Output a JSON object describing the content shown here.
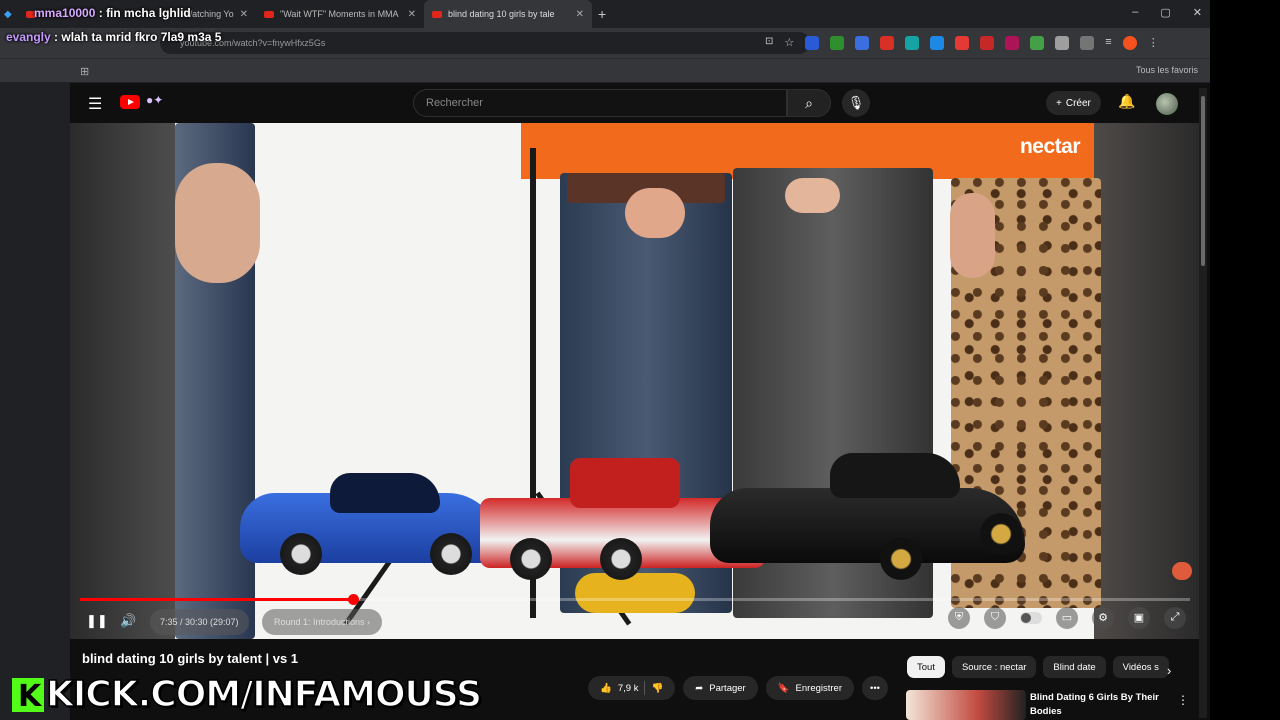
{
  "browser": {
    "tabs": [
      {
        "label": "Watching Yo",
        "active": false
      },
      {
        "label": "\"Wait WTF\" Moments in MMA",
        "active": false
      },
      {
        "label": "blind dating 10 girls by tale",
        "active": true
      }
    ],
    "new_tab": "+",
    "url": "youtube.com/watch?v=fnywHfxz5Gs",
    "bookmarks_folder": "Tous les favoris",
    "window_controls": [
      "–",
      "▢",
      "✕"
    ]
  },
  "youtube": {
    "search_placeholder": "Rechercher",
    "create_label": "Créer",
    "player": {
      "brand_banner": "nectar",
      "time": "7:35 / 30:30 (29:07)",
      "chapter": "Round 1: Introductions ›",
      "progress": 0.246
    },
    "video_title": "blind dating 10 girls by talent | vs 1",
    "chips": [
      {
        "label": "Tout",
        "selected": true
      },
      {
        "label": "Source : nectar",
        "selected": false
      },
      {
        "label": "Blind date",
        "selected": false
      },
      {
        "label": "Vidéos s",
        "selected": false
      }
    ],
    "actions": {
      "likes": "7,9 k",
      "share": "Partager",
      "save": "Enregistrer",
      "more": "•••"
    },
    "recommendation": {
      "title": "Blind Dating 6 Girls By Their Bodies"
    }
  },
  "overlay": {
    "chat": [
      {
        "user": "mma10000",
        "message": ": fin mcha lghlid"
      },
      {
        "user": "evangly",
        "message": ": wlah ta mrid fkro 7la9 m3a 5"
      }
    ],
    "kick_icon": "K",
    "kick_url": "KICK.COM/INFAMOUSS",
    "accent": "#53fc18"
  },
  "icons": [
    "menu-icon",
    "search-icon",
    "mic-icon",
    "bell-icon",
    "pause-icon",
    "volume-icon",
    "settings-icon",
    "fullscreen-icon",
    "like-icon",
    "dislike-icon",
    "share-icon",
    "save-icon"
  ]
}
